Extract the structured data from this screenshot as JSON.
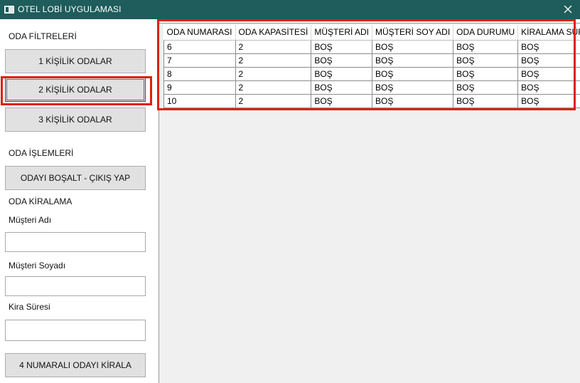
{
  "window": {
    "title": "OTEL LOBİ UYGULAMASI"
  },
  "sidebar": {
    "filters_heading": "ODA FİLTRELERİ",
    "filter_buttons": [
      "1 KİŞİLİK ODALAR",
      "2 KİŞİLİK ODALAR",
      "3 KİŞİLİK ODALAR"
    ],
    "operations_heading": "ODA İŞLEMLERİ",
    "checkout_button": "ODAYI BOŞALT - ÇIKIŞ YAP",
    "rental_heading": "ODA KİRALAMA",
    "customer_name_label": "Müşteri Adı",
    "customer_name_value": "",
    "customer_surname_label": "Müşteri Soyadı",
    "customer_surname_value": "",
    "rental_period_label": "Kira Süresi",
    "rental_period_value": "",
    "rent_button": "4 NUMARALI ODAYI KİRALA"
  },
  "grid": {
    "columns": [
      "ODA NUMARASI",
      "ODA KAPASİTESİ",
      "MÜŞTERİ ADI",
      "MÜŞTERİ SOY ADI",
      "ODA DURUMU",
      "KİRALAMA SÜRESİ"
    ],
    "rows": [
      [
        "6",
        "2",
        "BOŞ",
        "BOŞ",
        "BOŞ",
        "BOŞ"
      ],
      [
        "7",
        "2",
        "BOŞ",
        "BOŞ",
        "BOŞ",
        "BOŞ"
      ],
      [
        "8",
        "2",
        "BOŞ",
        "BOŞ",
        "BOŞ",
        "BOŞ"
      ],
      [
        "9",
        "2",
        "BOŞ",
        "BOŞ",
        "BOŞ",
        "BOŞ"
      ],
      [
        "10",
        "2",
        "BOŞ",
        "BOŞ",
        "BOŞ",
        "BOŞ"
      ]
    ]
  },
  "colors": {
    "titlebar": "#1f5c5c",
    "highlight": "#e0200e",
    "button": "#e1e1e1"
  },
  "icons": {
    "app": "window-icon",
    "close": "close-icon"
  }
}
